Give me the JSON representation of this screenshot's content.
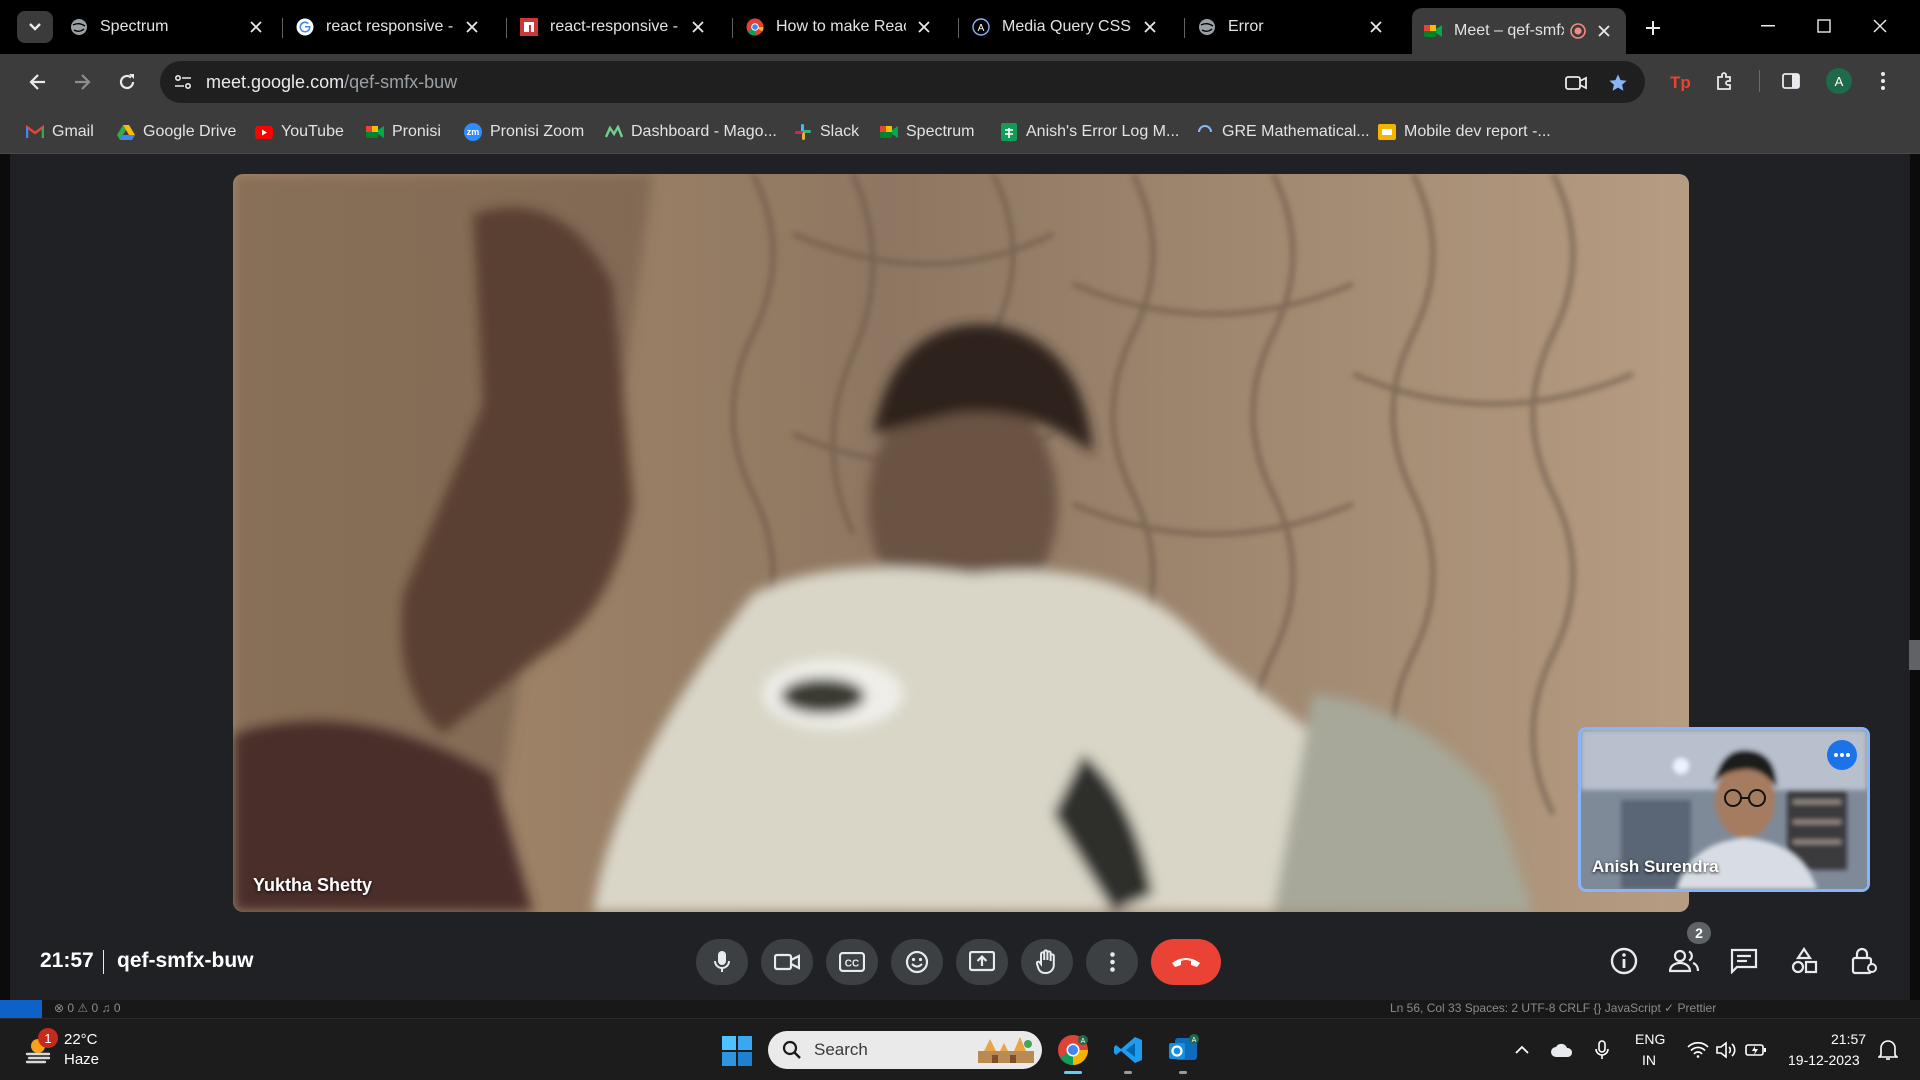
{
  "browser": {
    "tabs": [
      {
        "title": "Spectrum",
        "icon": "globe-icon"
      },
      {
        "title": "react responsive - Go",
        "icon": "google-icon"
      },
      {
        "title": "react-responsive - np",
        "icon": "npm-icon"
      },
      {
        "title": "How to make React A",
        "icon": "chrome-icon"
      },
      {
        "title": "Media Query CSS Tu",
        "icon": "a11y-icon"
      },
      {
        "title": "Error",
        "icon": "globe-icon"
      },
      {
        "title": "Meet – qef-smfx",
        "icon": "meet-icon",
        "active": true,
        "recording": true
      }
    ],
    "url_domain": "meet.google.com",
    "url_path": "/qef-smfx-buw",
    "profile_initial": "A",
    "bookmarks": [
      {
        "label": "Gmail",
        "icon": "gmail-icon"
      },
      {
        "label": "Google Drive",
        "icon": "drive-icon"
      },
      {
        "label": "YouTube",
        "icon": "youtube-icon"
      },
      {
        "label": "Pronisi",
        "icon": "meet-icon"
      },
      {
        "label": "Pronisi Zoom",
        "icon": "zoom-icon",
        "badge": "zm"
      },
      {
        "label": "Dashboard - Mago...",
        "icon": "mago-icon"
      },
      {
        "label": "Slack",
        "icon": "slack-icon"
      },
      {
        "label": "Spectrum",
        "icon": "meet-icon"
      },
      {
        "label": "Anish's Error Log M...",
        "icon": "sheets-icon"
      },
      {
        "label": "GRE Mathematical...",
        "icon": "loading-icon"
      },
      {
        "label": "Mobile dev report -...",
        "icon": "slides-icon"
      }
    ]
  },
  "meet": {
    "main_participant": "Yuktha Shetty",
    "self_participant": "Anish Surendra",
    "time": "21:57",
    "meeting_code": "qef-smfx-buw",
    "participant_count": "2"
  },
  "statusbar": {
    "left": "⊗ 0 ⚠ 0   ♫ 0",
    "right": "Ln 56, Col 33    Spaces: 2    UTF-8    CRLF    {} JavaScript    ✓ Prettier"
  },
  "taskbar": {
    "weather_temp": "22°C",
    "weather_cond": "Haze",
    "weather_badge": "1",
    "search_placeholder": "Search",
    "lang_line1": "ENG",
    "lang_line2": "IN",
    "clock_time": "21:57",
    "clock_date": "19-12-2023"
  },
  "colors": {
    "accent_blue": "#8ab4f8",
    "end_call_red": "#ea4335",
    "meet_bg": "#202124"
  }
}
